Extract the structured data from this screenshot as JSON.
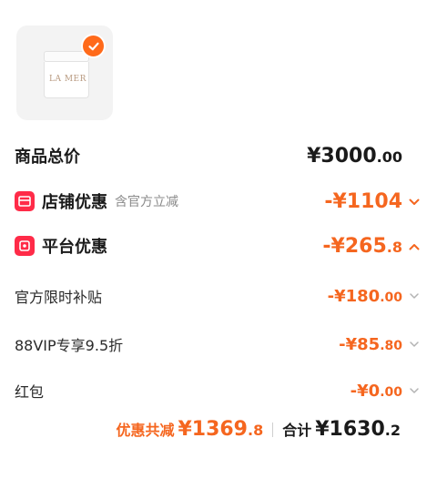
{
  "product": {
    "image_text": "LA MER",
    "selected": true,
    "check_icon": "check-icon"
  },
  "total": {
    "label": "商品总价",
    "amount_int": "¥3000",
    "amount_dec": ".00"
  },
  "shop_discount": {
    "icon": "shop-coupon-icon",
    "label": "店铺优惠",
    "note": "含官方立减",
    "amount_int": "-¥1104",
    "amount_dec": "",
    "expanded": false
  },
  "platform_discount": {
    "icon": "platform-coupon-icon",
    "label": "平台优惠",
    "amount_int": "-¥265",
    "amount_dec": ".8",
    "expanded": true,
    "items": [
      {
        "label": "官方限时补贴",
        "amount_int": "-¥180",
        "amount_dec": ".00"
      },
      {
        "label": "88VIP专享9.5折",
        "amount_int": "-¥85",
        "amount_dec": ".80"
      },
      {
        "label": "红包",
        "amount_int": "-¥0",
        "amount_dec": ".00"
      }
    ]
  },
  "summary": {
    "discount_label": "优惠共减",
    "discount_int": "¥1369",
    "discount_dec": ".8",
    "total_label": "合计",
    "total_int": "¥1630",
    "total_dec": ".2"
  },
  "colors": {
    "accent": "#f5661f",
    "badge": "#ff6a1a",
    "coupon_red": "#ff2b48"
  }
}
